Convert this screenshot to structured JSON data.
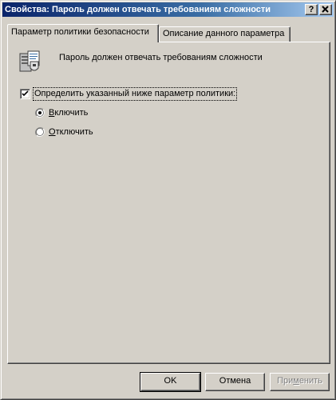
{
  "window": {
    "title": "Свойства: Пароль должен отвечать требованиям сложности",
    "help_label": "?",
    "close_label": "×"
  },
  "tabs": [
    {
      "label": "Параметр политики безопасности",
      "active": true
    },
    {
      "label": "Описание данного параметра",
      "active": false
    }
  ],
  "policy": {
    "icon": "security-policy-server-icon",
    "title": "Пароль должен отвечать требованиям сложности"
  },
  "define_setting": {
    "label": "Определить указанный ниже параметр политики:",
    "checked": true
  },
  "options": [
    {
      "label_mnemonic": "В",
      "label_rest": "ключить",
      "selected": true
    },
    {
      "label_mnemonic": "О",
      "label_rest": "тключить",
      "selected": false
    }
  ],
  "buttons": {
    "ok": "OK",
    "cancel": "Отмена",
    "apply_mnemonic": "м",
    "apply_before": "При",
    "apply_after": "енить"
  }
}
